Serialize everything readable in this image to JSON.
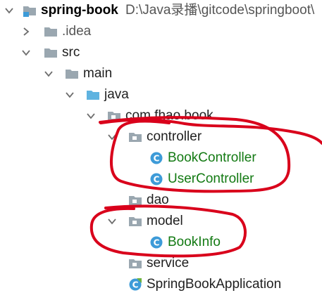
{
  "tree": {
    "root": {
      "name": "spring-book",
      "path": "D:\\Java录播\\gitcode\\springboot\\"
    },
    "idea": {
      "name": ".idea"
    },
    "src": {
      "name": "src"
    },
    "main": {
      "name": "main"
    },
    "java": {
      "name": "java"
    },
    "package": {
      "name": "com.fhao.book"
    },
    "controller": {
      "name": "controller"
    },
    "book_controller": {
      "name": "BookController"
    },
    "user_controller": {
      "name": "UserController"
    },
    "dao": {
      "name": "dao"
    },
    "model": {
      "name": "model"
    },
    "book_info": {
      "name": "BookInfo"
    },
    "service": {
      "name": "service"
    },
    "application": {
      "name": "SpringBookApplication"
    }
  },
  "colors": {
    "folder": "#9aa7b0",
    "source_folder": "#5fb3e0",
    "class_icon": "#3d9bd8",
    "vcs_added_text": "#137a13",
    "annotation": "#d9001b"
  },
  "icons": {
    "expanded": "chevron-down-icon",
    "collapsed": "chevron-right-icon",
    "module": "module-folder-icon",
    "folder": "folder-icon",
    "source_root": "source-root-folder-icon",
    "package": "package-icon",
    "class": "java-class-icon",
    "spring_boot_class": "spring-boot-class-icon"
  }
}
